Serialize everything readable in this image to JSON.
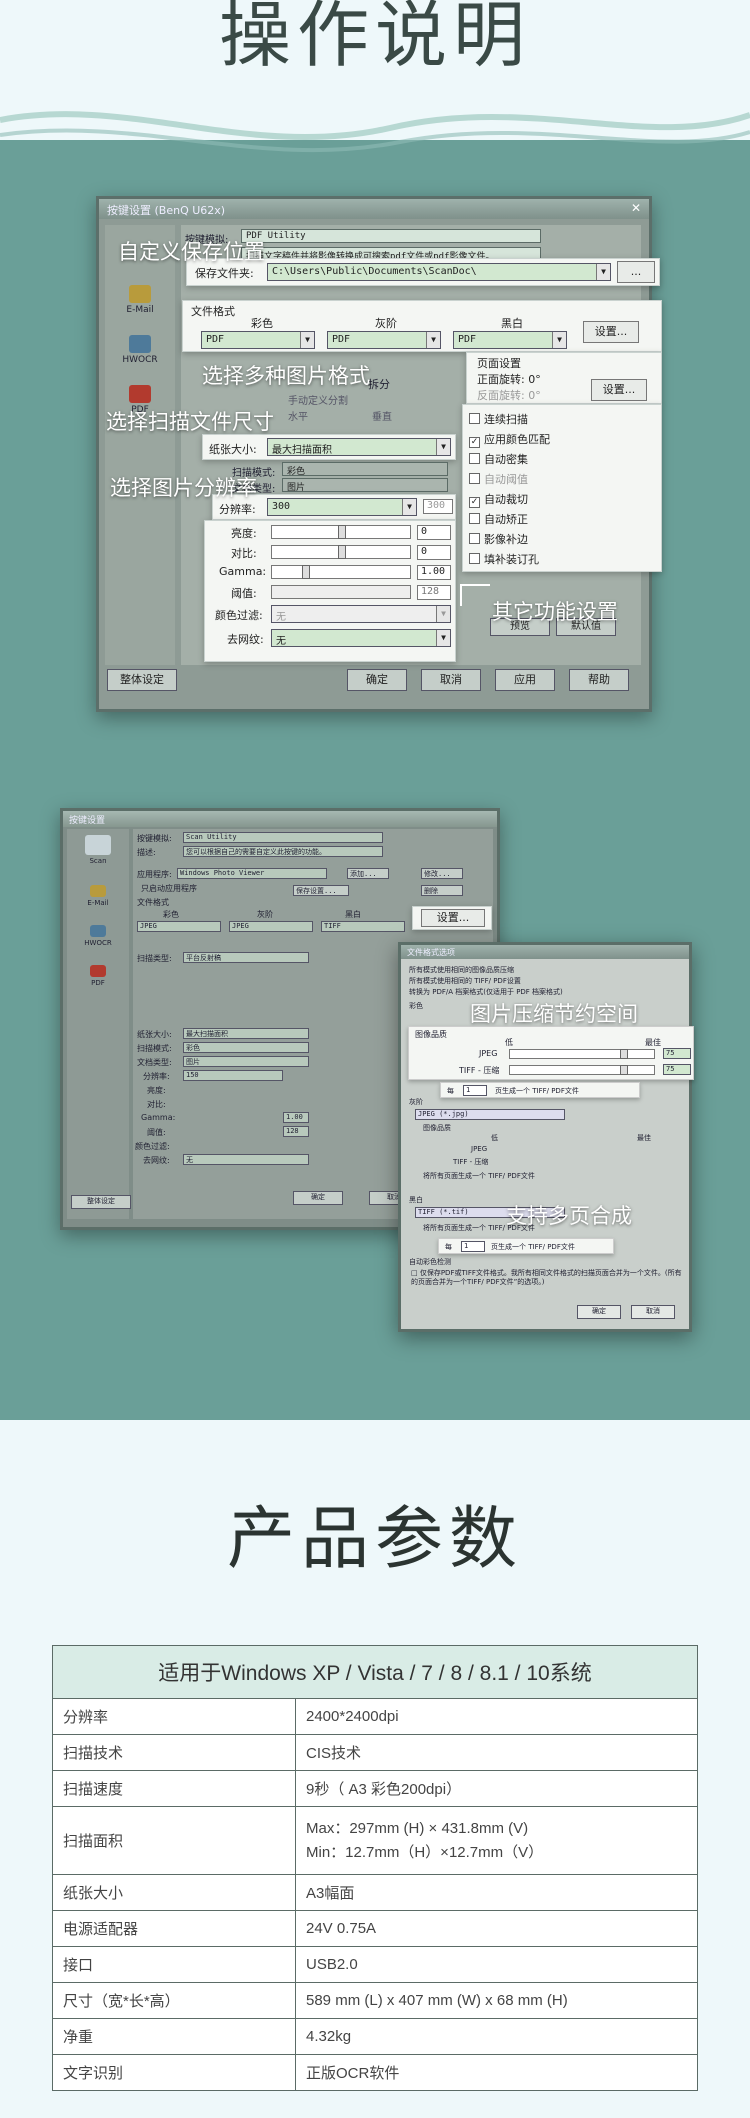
{
  "header": {
    "title": "操作说明"
  },
  "screenshot1": {
    "window_title": "按键设置 (BenQ U62x)",
    "close_label": "✕",
    "side_items": [
      "E-Mail",
      "HWOCR",
      "PDF"
    ],
    "app_label": "按键模拟:",
    "app_value": "PDF Utility",
    "desc_value": "扫描文字稿件并将影像转换成可搜索pdf文件或pdf影像文件。",
    "save_folder_label": "保存文件夹:",
    "save_folder_value": "C:\\Users\\Public\\Documents\\ScanDoc\\",
    "browse_label": "...",
    "file_format_label": "文件格式",
    "format_headers": [
      "彩色",
      "灰阶",
      "黑白"
    ],
    "format_values": [
      "PDF",
      "PDF",
      "PDF"
    ],
    "settings_label": "设置...",
    "page_settings_label": "页面设置",
    "front_rotate": "正面旋转: 0°",
    "back_rotate": "反面旋转: 0°",
    "page_settings_btn": "设置...",
    "split_label": "拆分",
    "manual_split": "手动定义分割",
    "horizontal": "水平",
    "vertical": "垂直",
    "paper_size_label": "纸张大小:",
    "paper_size_value": "最大扫描面积",
    "scan_mode_label": "扫描模式:",
    "scan_mode_value": "彩色",
    "doc_type_label": "文档类型:",
    "doc_type_value": "图片",
    "resolution_label": "分辨率:",
    "resolution_value": "300",
    "resolution_dim": "300",
    "brightness_label": "亮度:",
    "brightness_value": "0",
    "contrast_label": "对比:",
    "contrast_value": "0",
    "gamma_label": "Gamma:",
    "gamma_value": "1.00",
    "threshold_label": "阈值:",
    "threshold_value": "128",
    "color_filter_label": "颜色过滤:",
    "color_filter_value": "无",
    "descreen_label": "去网纹:",
    "descreen_value": "无",
    "features": [
      {
        "label": "连续扫描",
        "checked": false,
        "dim": false
      },
      {
        "label": "应用颜色匹配",
        "checked": true,
        "dim": false
      },
      {
        "label": "自动密集",
        "checked": false,
        "dim": false
      },
      {
        "label": "自动阈值",
        "checked": false,
        "dim": true
      },
      {
        "label": "自动裁切",
        "checked": true,
        "dim": false
      },
      {
        "label": "自动矫正",
        "checked": false,
        "dim": false
      },
      {
        "label": "影像补边",
        "checked": false,
        "dim": false
      },
      {
        "label": "填补装订孔",
        "checked": false,
        "dim": false
      }
    ],
    "preview_btn": "预览",
    "default_btn": "默认值",
    "buttons": {
      "overall": "整体设定",
      "ok": "确定",
      "cancel": "取消",
      "apply": "应用",
      "help": "帮助"
    },
    "callouts": {
      "custom_save": "自定义保存位置",
      "multi_format": "选择多种图片格式",
      "file_size": "选择扫描文件尺寸",
      "resolution": "选择图片分辨率",
      "other": "其它功能设置"
    }
  },
  "screenshot2": {
    "window_title": "按键设置",
    "side_items": [
      "Scan",
      "E-Mail",
      "HWOCR",
      "PDF"
    ],
    "app_label": "按键模拟:",
    "app_value": "Scan Utility",
    "desc_label": "描述:",
    "desc_value": "您可以根据自己的需要自定义此按键的功能。",
    "app_prog_label": "应用程序:",
    "app_prog_value": "Windows Photo Viewer",
    "add_label": "添加...",
    "modify_label": "修改...",
    "delete_label": "删除",
    "only_launch": "只启动应用程序",
    "save_settings": "保存设置...",
    "file_format": "文件格式",
    "format_headers": [
      "彩色",
      "灰阶",
      "黑白"
    ],
    "format_values": [
      "JPEG",
      "JPEG",
      "TIFF"
    ],
    "settings_btn": "设置...",
    "scan_type_label": "扫描类型:",
    "scan_type_value": "平台反射稿",
    "paper_size_label": "纸张大小:",
    "paper_size_value": "最大扫描面积",
    "scan_mode_label": "扫描模式:",
    "scan_mode_value": "彩色",
    "doc_type_label": "文档类型:",
    "doc_type_value": "图片",
    "resolution_label": "分辨率:",
    "resolution_value": "150",
    "brightness_label": "亮度:",
    "contrast_label": "对比:",
    "gamma_label": "Gamma:",
    "gamma_value": "1.00",
    "threshold_label": "阈值:",
    "threshold_value": "128",
    "color_filter_label": "颜色过滤:",
    "descreen_label": "去网纹:",
    "descreen_value": "无",
    "buttons": {
      "overall": "整体设定",
      "ok": "确定",
      "cancel": "取消"
    },
    "dialog": {
      "title": "文件格式选项",
      "options": [
        "所有模式使用相同的图像品质压缩",
        "所有模式使用相同的 TIFF/ PDF设置",
        "转换为 PDF/A 档案格式(仅适用于 PDF 档案格式)"
      ],
      "color_label": "彩色",
      "quality_label": "图像品质",
      "low_label": "低",
      "best_label": "最佳",
      "jpeg_label": "JPEG",
      "tiff_label": "TIFF - 压缩",
      "jpeg_value": "75",
      "tiff_value": "75",
      "all_pages_opt": "将所有页面生成一个 TIFF/ PDF文件",
      "every_opt": "每",
      "every_value": "1",
      "every_suffix": "页生成一个 TIFF/ PDF文件",
      "gray_label": "灰阶",
      "gray_format": "JPEG (*.jpg)",
      "bw_label": "黑白",
      "bw_format": "TIFF (*.tif)",
      "auto_detect": "自动彩色检测",
      "note": "□ 仅保存PDF或TIFF文件格式。我所有相同文件格式的扫描页面合并为一个文件。(所有的页面合并为一个TIFF/ PDF文件”的选项。)",
      "ok": "确定",
      "cancel": "取消"
    },
    "callouts": {
      "compress": "图片压缩节约空间",
      "multipage": "支持多页合成"
    }
  },
  "specs": {
    "title": "产品参数",
    "heading": "适用于Windows XP / Vista / 7 / 8 / 8.1 / 10系统",
    "rows": [
      {
        "key": "分辨率",
        "value": "2400*2400dpi"
      },
      {
        "key": "扫描技术",
        "value": "CIS技术"
      },
      {
        "key": "扫描速度",
        "value": "9秒（ A3 彩色200dpi）"
      },
      {
        "key": "扫描面积",
        "value": "Max：297mm (H) × 431.8mm (V)",
        "value2": "Min：12.7mm（H）×12.7mm（V）"
      },
      {
        "key": "纸张大小",
        "value": "A3幅面"
      },
      {
        "key": "电源适配器",
        "value": "24V  0.75A"
      },
      {
        "key": "接口",
        "value": "USB2.0"
      },
      {
        "key": "尺寸（宽*长*高）",
        "value": "589 mm (L) x 407 mm (W) x 68 mm (H)"
      },
      {
        "key": "净重",
        "value": "4.32kg"
      },
      {
        "key": "文字识别",
        "value": "正版OCR软件"
      }
    ]
  }
}
